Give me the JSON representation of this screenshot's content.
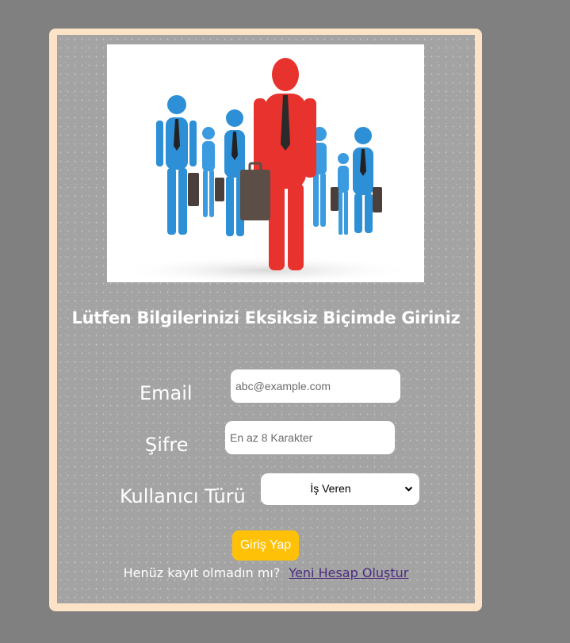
{
  "form": {
    "title": "Lütfen Bilgilerinizi Eksiksiz Biçimde Giriniz",
    "email_label": "Email",
    "email_placeholder": "abc@example.com",
    "password_label": "Şifre",
    "password_placeholder": "En az 8 Karakter",
    "user_type_label": "Kullanıcı Türü",
    "user_type_selected": "İş Veren",
    "submit_label": "Giriş Yap",
    "no_account_text": "Henüz kayıt olmadın mı?",
    "create_account_link": "Yeni Hesap Oluştur"
  },
  "colors": {
    "page_bg": "#808080",
    "card_border": "#fce2c7",
    "card_bg": "#a3a3a3",
    "button": "#ffc107",
    "link": "#4b2b7f",
    "leader_figure": "#e8322d",
    "team_figures": "#2d8fd6"
  },
  "icons": {
    "hero_image": "business-team-leader-illustration",
    "select_chevron": "chevron-down-icon"
  }
}
